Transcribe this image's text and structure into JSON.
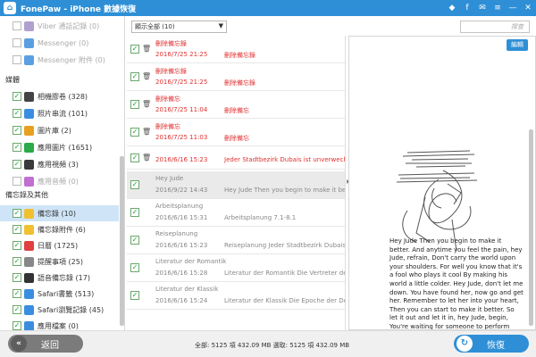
{
  "window": {
    "title": "FonePaw - iPhone 數據恢復",
    "logo_glyph": "⌂"
  },
  "title_icons": [
    "gem-icon",
    "facebook-icon",
    "chat-icon",
    "menu-icon",
    "minimize-icon",
    "close-icon"
  ],
  "title_icon_glyphs": [
    "◆",
    "f",
    "✉",
    "≡",
    "—",
    "✕"
  ],
  "sidebar": {
    "top_items": [
      {
        "label": "Viber 通話記錄 (0)",
        "icon": "viber-icon",
        "color": "#b0a0d0",
        "checked": false
      },
      {
        "label": "Messenger (0)",
        "icon": "messenger-icon",
        "color": "#5aa0e0",
        "checked": false
      },
      {
        "label": "Messenger 附件 (0)",
        "icon": "messenger-icon",
        "color": "#5aa0e0",
        "checked": false
      }
    ],
    "section_media": "媒體",
    "media_items": [
      {
        "label": "相機膠卷 (328)",
        "icon": "camera-icon",
        "color": "#444"
      },
      {
        "label": "照片串流 (101)",
        "icon": "photostream-icon",
        "color": "#3a8ee0"
      },
      {
        "label": "圖片庫 (2)",
        "icon": "photo-library-icon",
        "color": "#e8a020"
      },
      {
        "label": "應用圖片 (1651)",
        "icon": "app-photo-icon",
        "color": "#2aaa4a"
      },
      {
        "label": "應用視頻 (3)",
        "icon": "app-video-icon",
        "color": "#3a3a3a"
      },
      {
        "label": "應用音頻 (0)",
        "icon": "app-audio-icon",
        "color": "#c070d0",
        "gray": true
      }
    ],
    "section_memo": "備忘錄及其他",
    "memo_items": [
      {
        "label": "備忘錄 (10)",
        "icon": "notes-icon",
        "color": "#f0c030",
        "selected": true
      },
      {
        "label": "備忘錄附件 (6)",
        "icon": "notes-attachment-icon",
        "color": "#f0c030"
      },
      {
        "label": "日曆 (1725)",
        "icon": "calendar-icon",
        "color": "#e04040"
      },
      {
        "label": "提醒事項 (25)",
        "icon": "reminders-icon",
        "color": "#888"
      },
      {
        "label": "語音備忘錄 (17)",
        "icon": "voice-memo-icon",
        "color": "#333"
      },
      {
        "label": "Safari書籤 (513)",
        "icon": "safari-bookmark-icon",
        "color": "#3a8ee0"
      },
      {
        "label": "Safari瀏覽記錄 (45)",
        "icon": "safari-history-icon",
        "color": "#3a8ee0"
      },
      {
        "label": "應用檔案 (0)",
        "icon": "app-document-icon",
        "color": "#3a8ee0"
      }
    ]
  },
  "filter": {
    "selected": "顯示全部 (10)"
  },
  "search": {
    "placeholder": "搜查"
  },
  "list": [
    {
      "title": "刪除備忘錄",
      "date": "2016/7/25 21:25",
      "preview": "刪除備忘錄",
      "style": "red",
      "trash": true
    },
    {
      "title": "刪除備忘錄",
      "date": "2016/7/25 21:25",
      "preview": "刪除備忘錄",
      "style": "red",
      "trash": true
    },
    {
      "title": "刪除備忘",
      "date": "2016/7/25 11:04",
      "preview": "刪除備忘",
      "style": "red",
      "trash": true
    },
    {
      "title": "刪除備忘",
      "date": "2016/7/25 11:03",
      "preview": "刪除備忘",
      "style": "red",
      "trash": true
    },
    {
      "title": "",
      "date": "2016/6/16 15:23",
      "preview": "Jeder Stadtbezirk Dubais ist unverwechselbar",
      "style": "red",
      "trash": true,
      "single": true
    },
    {
      "title": "Hey Jude",
      "date": "2016/9/22 14:43",
      "preview": "Hey Jude Then you begin to make it better",
      "style": "gray",
      "trash": false,
      "highlight": true
    },
    {
      "title": "Arbeitsplanung",
      "date": "2016/6/16 15:31",
      "preview": "Arbeitsplanung 7.1-8.1",
      "style": "gray",
      "trash": false
    },
    {
      "title": "Reiseplanung",
      "date": "2016/6/16 15:23",
      "preview": "Reiseplanung Jeder Stadtbezirk Dubais",
      "style": "gray",
      "trash": false
    },
    {
      "title": "Literatur der Romantik",
      "date": "2016/6/16 15:28",
      "preview": "Literatur der Romantik Die Vertreter der",
      "style": "gray",
      "trash": false
    },
    {
      "title": "Literatur der Klassik",
      "date": "2016/6/16 15:24",
      "preview": "Literatur der Klassik Die Epoche der Deutschen",
      "style": "gray",
      "trash": false
    }
  ],
  "preview_pane": {
    "edit_label": "編輯",
    "note_text": "Hey Jude Then you begin to make it better. And anytime you feel the pain, hey Jude, refrain,    Don't carry the world upon your shoulders. For well you know that it's a fool who plays it cool By making his world a little colder. Hey Jude, don't let me down. You have found her, now go and get her. Remember to let her into your heart, Then you can start to make it better. So let it out and let it in, hey Jude, begin, You're waiting for someone to perform with. And don't you know that it's just you, hey Jude, you'll"
  },
  "footer": {
    "back_label": "返回",
    "status": "全部: 5125 項 432.09 MB 選取: 5125 項 432.09 MB",
    "recover_label": "恢復"
  }
}
